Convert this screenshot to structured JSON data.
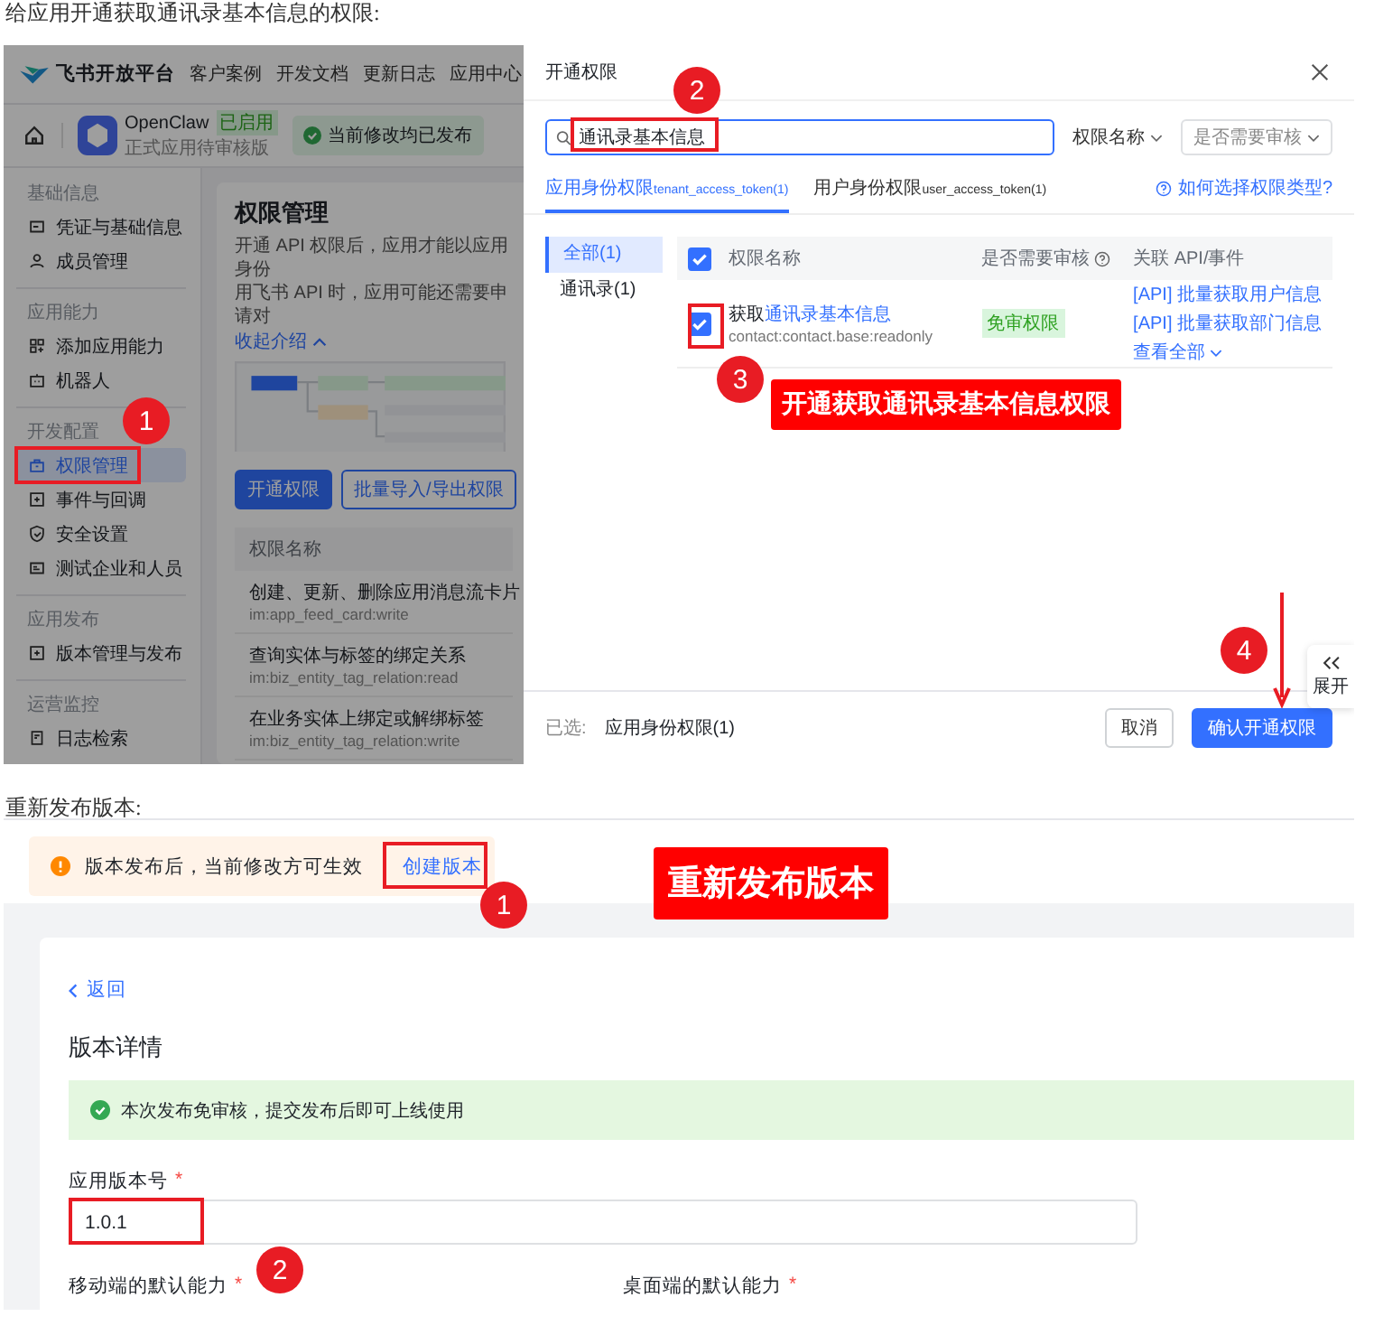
{
  "caption_1": "给应用开通获取通讯录基本信息的权限:",
  "screenshot_1": {
    "top_nav": {
      "logo_text": "飞书开放平台",
      "links": [
        "客户案例",
        "开发文档",
        "更新日志",
        "应用中心"
      ]
    },
    "app_bar": {
      "app_name": "OpenClaw",
      "app_tag": "已启用",
      "app_subtitle": "正式应用待审核版",
      "status": "当前修改均已发布"
    },
    "sidebar": {
      "groups": [
        {
          "title": "基础信息",
          "items": [
            {
              "label": "凭证与基础信息",
              "kind": "card",
              "selected": false
            },
            {
              "label": "成员管理",
              "kind": "user",
              "selected": false
            }
          ]
        },
        {
          "title": "应用能力",
          "items": [
            {
              "label": "添加应用能力",
              "kind": "apps",
              "selected": false
            },
            {
              "label": "机器人",
              "kind": "robot",
              "selected": false
            }
          ]
        },
        {
          "title": "开发配置",
          "items": [
            {
              "label": "权限管理",
              "kind": "lock",
              "selected": true
            },
            {
              "label": "事件与回调",
              "kind": "plus",
              "selected": false
            },
            {
              "label": "安全设置",
              "kind": "shield",
              "selected": false
            },
            {
              "label": "测试企业和人员",
              "kind": "id",
              "selected": false
            }
          ]
        },
        {
          "title": "应用发布",
          "items": [
            {
              "label": "版本管理与发布",
              "kind": "plus",
              "selected": false
            }
          ]
        },
        {
          "title": "运营监控",
          "items": [
            {
              "label": "日志检索",
              "kind": "log",
              "selected": false
            }
          ]
        }
      ]
    },
    "content": {
      "title": "权限管理",
      "description_lines": [
        "开通 API 权限后，应用才能以应用身份",
        "用飞书 API 时，应用可能还需要申请对"
      ],
      "collapse_link": "收起介绍",
      "buttons": [
        {
          "label": "开通权限",
          "kind": "primary"
        },
        {
          "label": "批量导入/导出权限",
          "kind": "outline"
        }
      ],
      "table": {
        "columns": [
          "权限名称"
        ],
        "rows": [
          {
            "name": "创建、更新、删除应用消息流卡片",
            "code": "im:app_feed_card:write"
          },
          {
            "name": "查询实体与标签的绑定关系",
            "code": "im:biz_entity_tag_relation:read"
          },
          {
            "name": "在业务实体上绑定或解绑标签",
            "code": "im:biz_entity_tag_relation:write"
          }
        ]
      }
    },
    "drawer": {
      "title": "开通权限",
      "search": {
        "value": "通讯录基本信息"
      },
      "filters": [
        "权限名称",
        "是否需要审核"
      ],
      "tabs": [
        {
          "label": "应用身份权限",
          "token": "tenant_access_token(1)",
          "selected": true
        },
        {
          "label": "用户身份权限",
          "token": "user_access_token(1)",
          "selected": false
        }
      ],
      "help_link": "如何选择权限类型?",
      "categories": [
        {
          "label": "全部(1)",
          "selected": true
        },
        {
          "label": "通讯录(1)",
          "selected": false
        }
      ],
      "table": {
        "all_checked": true,
        "columns": [
          "权限名称",
          "是否需要审核",
          "关联 API/事件"
        ],
        "rows": [
          {
            "checked": true,
            "name_prefix": "获取",
            "name_link": "通讯录基本信息",
            "code": "contact:contact.base:readonly",
            "review_tag": "免审权限",
            "apis": [
              "[API] 批量获取用户信息",
              "[API] 批量获取部门信息"
            ],
            "more_link": "查看全部"
          }
        ]
      },
      "footer": {
        "selected_label": "已选:",
        "selected_value": "应用身份权限(1)",
        "buttons": [
          {
            "label": "取消",
            "kind": "secondary"
          },
          {
            "label": "确认开通权限",
            "kind": "primary"
          }
        ]
      },
      "side_tab": {
        "label": "展开"
      }
    },
    "banner": "开通获取通讯录基本信息权限",
    "callouts": [
      "1",
      "2",
      "3",
      "4"
    ]
  },
  "caption_2": "重新发布版本:",
  "screenshot_2": {
    "notice": {
      "text": "版本发布后，当前修改方可生效",
      "link": "创建版本"
    },
    "banner": "重新发布版本",
    "back_link": "返回",
    "title": "版本详情",
    "success_alert": "本次发布免审核，提交发布后即可上线使用",
    "version_field": {
      "label": "应用版本号",
      "required_mark": "*",
      "value": "1.0.1"
    },
    "capability_labels": [
      {
        "label": "移动端的默认能力",
        "required_mark": "*"
      },
      {
        "label": "桌面端的默认能力",
        "required_mark": "*"
      }
    ],
    "callouts": [
      "1",
      "2"
    ]
  }
}
